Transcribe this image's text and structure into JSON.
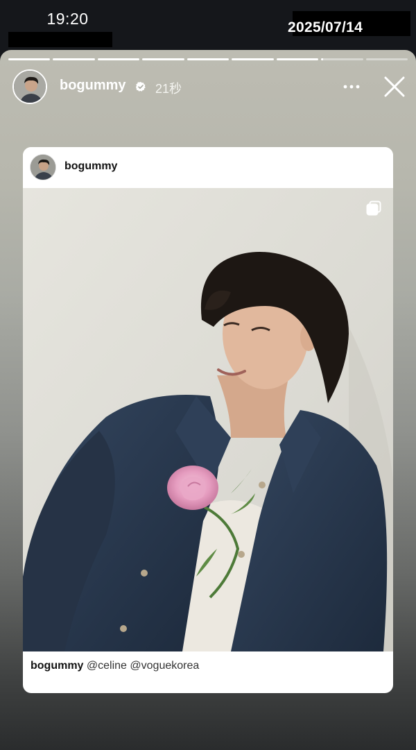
{
  "status_bar": {
    "time": "19:20",
    "date": "2025/07/14"
  },
  "story": {
    "progress": {
      "segments": 9,
      "completed": 7,
      "current_fraction": 0.05
    },
    "header": {
      "username": "bogummy",
      "verified": true,
      "elapsed": "21秒",
      "more_icon": "more-horizontal-icon",
      "close_icon": "close-icon"
    },
    "shared_post": {
      "username": "bogummy",
      "caption_user": "bogummy",
      "caption_text": "@celine @voguekorea",
      "carousel_icon": "carousel-icon",
      "image_description_colors": {
        "wall": "#dedcd5",
        "jacket": "#2a3a52",
        "rose": "#e7a0c2"
      }
    }
  },
  "colors": {
    "story_top": "#bdbcb2",
    "story_bottom": "#2a2c2d",
    "verified_badge": "#ffffff",
    "status_bg": "#15171b"
  }
}
